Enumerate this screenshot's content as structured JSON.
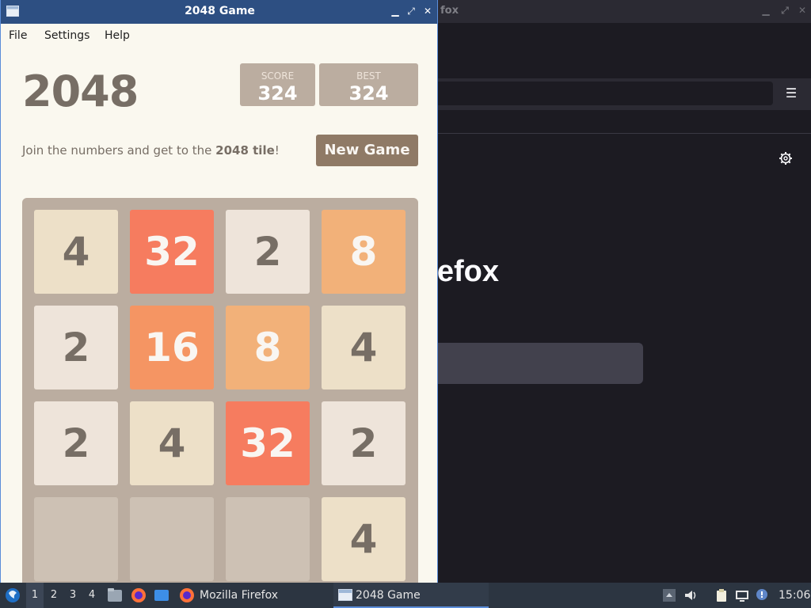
{
  "firefox": {
    "title": "Mozilla Firefox",
    "title_visible": "fox",
    "brand_visible": "efox"
  },
  "game_window": {
    "title": "2048 Game",
    "menu": [
      "File",
      "Settings",
      "Help"
    ]
  },
  "game": {
    "heading": "2048",
    "score": {
      "label": "SCORE",
      "value": "324"
    },
    "best": {
      "label": "BEST",
      "value": "324"
    },
    "intro_prefix": "Join the numbers and get to the ",
    "intro_bold": "2048 tile",
    "intro_suffix": "!",
    "new_game_label": "New Game",
    "board": [
      [
        "4",
        "32",
        "2",
        "8"
      ],
      [
        "2",
        "16",
        "8",
        "4"
      ],
      [
        "2",
        "4",
        "32",
        "2"
      ],
      [
        "",
        "",
        "",
        "4"
      ]
    ]
  },
  "colors": {
    "tile_2": "#eee4da",
    "tile_4": "#ede0c8",
    "tile_8": "#f2b179",
    "tile_16": "#f59563",
    "tile_32": "#f67c5f",
    "tile_empty": "#cdc1b4",
    "dark_text": "#776e65",
    "light_text": "#f9f6f2"
  },
  "taskbar": {
    "workspaces": [
      "1",
      "2",
      "3",
      "4"
    ],
    "tasks": [
      {
        "label": "Mozilla Firefox",
        "icon": "firefox-icon"
      },
      {
        "label": "2048 Game",
        "icon": "window-icon"
      }
    ],
    "clock": "15:06"
  }
}
